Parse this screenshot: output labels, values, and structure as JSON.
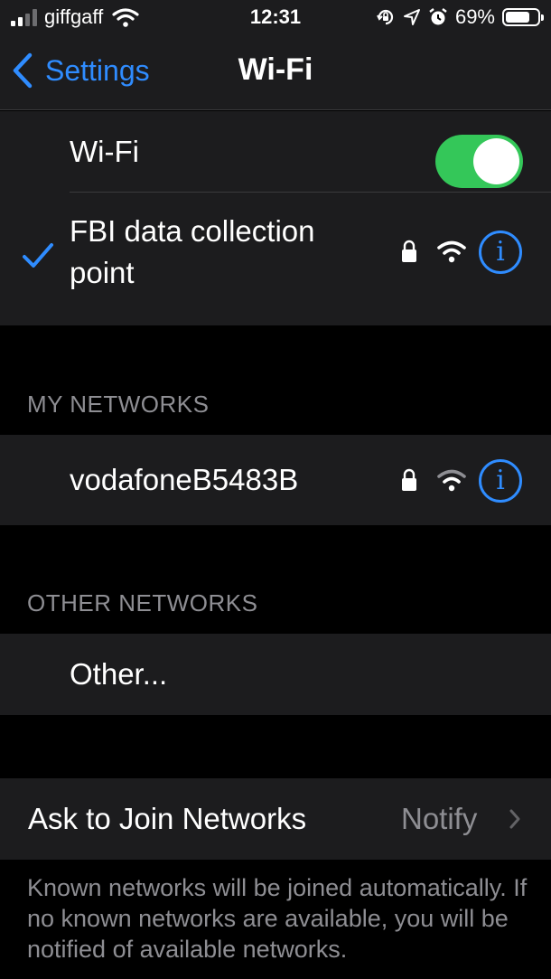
{
  "status_bar": {
    "carrier": "giffgaff",
    "time": "12:31",
    "battery": "69%",
    "icons": [
      "cellular-signal-icon",
      "wifi-icon",
      "orientation-lock-icon",
      "location-icon",
      "alarm-icon",
      "battery-icon"
    ]
  },
  "nav": {
    "back_label": "Settings",
    "title": "Wi-Fi"
  },
  "wifi_toggle": {
    "label": "Wi-Fi",
    "on": true,
    "color": "#34c759"
  },
  "connected": {
    "name_line1": "FBI data collection",
    "name_line2": "point",
    "secured": true
  },
  "my_networks": {
    "header": "MY NETWORKS",
    "items": [
      {
        "name": "vodafoneB5483B",
        "secured": true
      }
    ]
  },
  "other_networks": {
    "header": "OTHER NETWORKS",
    "other_label": "Other..."
  },
  "ask_to_join": {
    "label": "Ask to Join Networks",
    "value": "Notify"
  },
  "footer": {
    "text": "Known networks will be joined automatically. If no known networks are available, you will be notified of available networks."
  },
  "colors": {
    "accent": "#2f8cff",
    "background": "#000000",
    "cell": "#1c1c1e",
    "secondary_text": "#8e8e93"
  }
}
